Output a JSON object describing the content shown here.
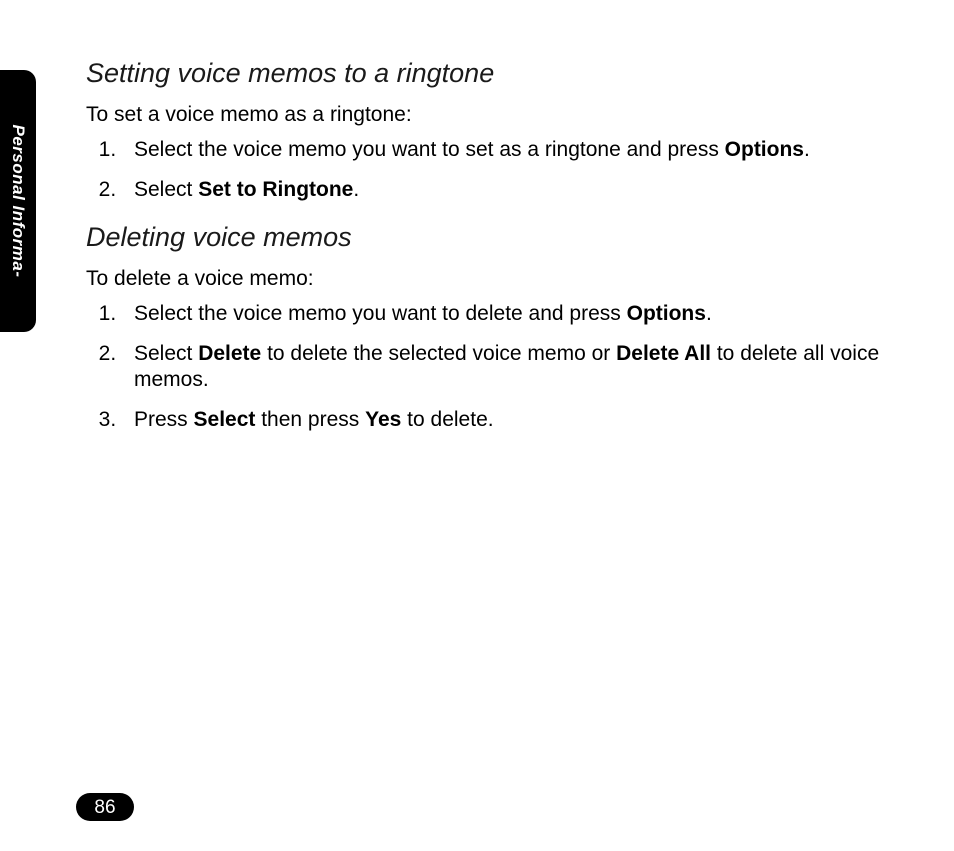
{
  "side_tab": "Personal Informa-",
  "section1": {
    "heading": "Setting voice memos to a ringtone",
    "intro": "To set a voice memo as a ringtone:",
    "steps": [
      {
        "pre": "Select the voice memo you want to set as a ringtone and press ",
        "b1": "Options",
        "post": "."
      },
      {
        "pre": "Select ",
        "b1": "Set to Ringtone",
        "post": "."
      }
    ]
  },
  "section2": {
    "heading": "Deleting voice memos",
    "intro": "To delete a voice memo:",
    "steps": [
      {
        "pre": "Select the voice memo you want to delete and press ",
        "b1": "Options",
        "post": "."
      },
      {
        "pre": "Select ",
        "b1": "Delete",
        "mid1": " to delete the selected voice memo or ",
        "b2": "Delete All",
        "post": " to delete all voice memos."
      },
      {
        "pre": "Press ",
        "b1": "Select",
        "mid1": " then press ",
        "b2": "Yes",
        "post": " to delete."
      }
    ]
  },
  "page_number": "86"
}
